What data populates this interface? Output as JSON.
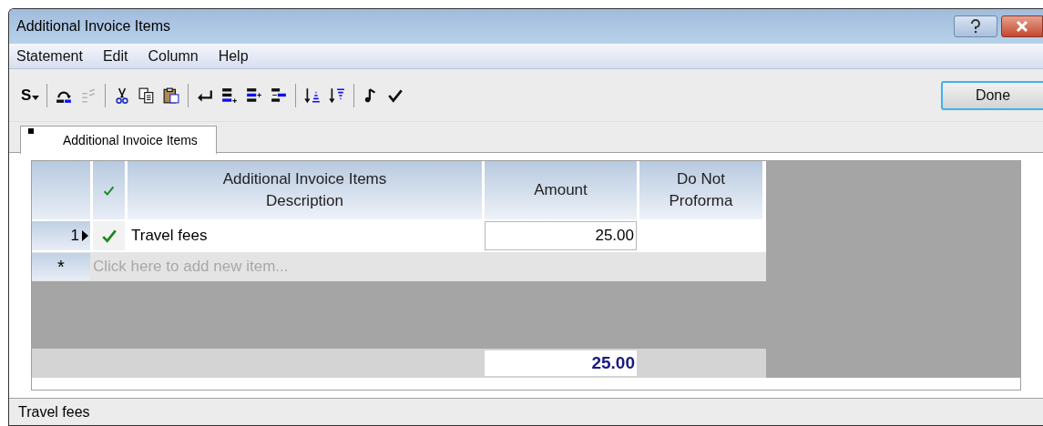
{
  "window": {
    "title": "Additional Invoice Items"
  },
  "menu": [
    "Statement",
    "Edit",
    "Column",
    "Help"
  ],
  "toolbar": {
    "dropdown_label": "S",
    "buttons": [
      {
        "disabled": false
      },
      {
        "disabled": true
      },
      {
        "disabled": false
      },
      {
        "disabled": false
      },
      {
        "disabled": false
      },
      {
        "disabled": false
      },
      {
        "disabled": false
      },
      {
        "disabled": false
      },
      {
        "disabled": false
      },
      {
        "disabled": false
      },
      {
        "disabled": false
      },
      {
        "disabled": false
      },
      {
        "disabled": false
      }
    ]
  },
  "done_button": "Done",
  "tabs": [
    {
      "label": "Additional Invoice Items",
      "selected": true
    }
  ],
  "table": {
    "columns": [
      "Additional Invoice Items\nDescription",
      "Amount",
      "Do Not\nProforma"
    ],
    "rows": [
      {
        "number": "1",
        "current": true,
        "checked": true,
        "description": "Travel fees",
        "amount": "25.00"
      }
    ],
    "new_row": {
      "marker": "*",
      "placeholder": "Click here to add new item..."
    },
    "total": "25.00"
  },
  "status_bar": "Travel fees"
}
